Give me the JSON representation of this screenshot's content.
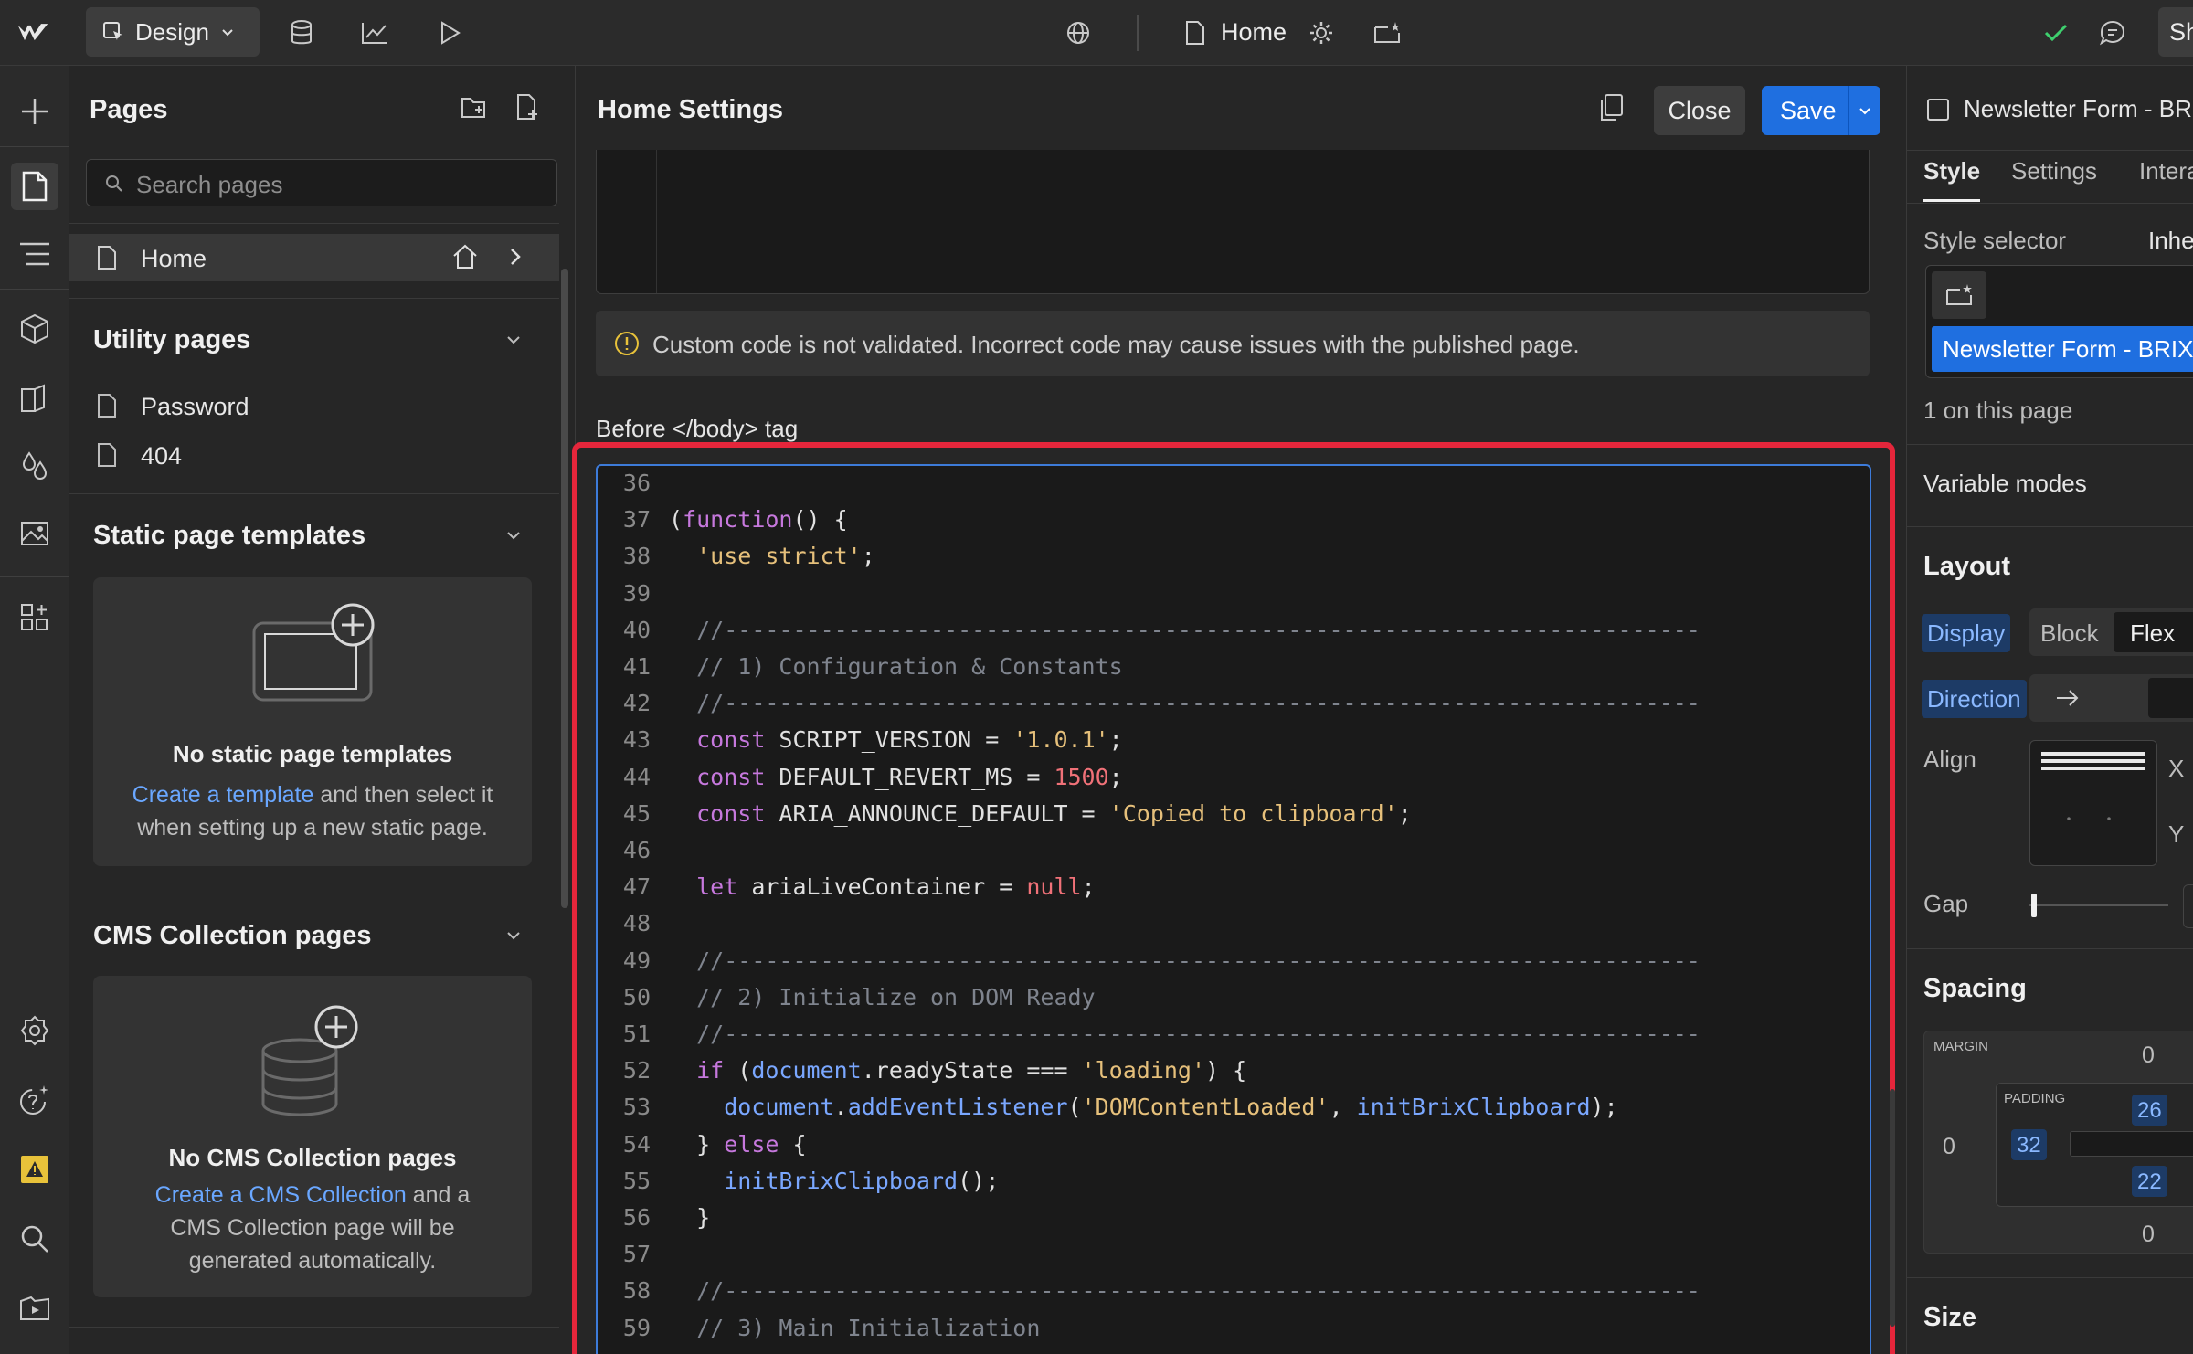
{
  "topbar": {
    "mode_label": "Design",
    "current_page": "Home",
    "share_label": "Sh"
  },
  "pages_panel": {
    "title": "Pages",
    "search_placeholder": "Search pages",
    "home_page": "Home",
    "utility": {
      "title": "Utility pages",
      "items": [
        "Password",
        "404"
      ]
    },
    "static_templates": {
      "title": "Static page templates",
      "empty_title": "No static page templates",
      "link": "Create a template",
      "desc_rest_1": " and then select it",
      "desc_rest_2": "when setting up a new static page."
    },
    "cms": {
      "title": "CMS Collection pages",
      "empty_title": "No CMS Collection pages",
      "link": "Create a CMS Collection",
      "desc_rest_1": " and a",
      "desc_rest_2": "CMS Collection page will be",
      "desc_rest_3": "generated automatically."
    }
  },
  "settings": {
    "title": "Home Settings",
    "close_label": "Close",
    "save_label": "Save",
    "warning": "Custom code is not validated. Incorrect code may cause issues with the published page.",
    "before_body_label": "Before </body> tag",
    "code_lines": [
      {
        "n": "36",
        "html": ""
      },
      {
        "n": "37",
        "html": "(<span class=\"k\">function</span>() {"
      },
      {
        "n": "38",
        "html": "  <span class=\"s\">'use strict'</span>;"
      },
      {
        "n": "39",
        "html": ""
      },
      {
        "n": "40",
        "html": "  <span class=\"c\">//-----------------------------------------------------------------------</span>"
      },
      {
        "n": "41",
        "html": "  <span class=\"c\">// 1) Configuration &amp; Constants</span>"
      },
      {
        "n": "42",
        "html": "  <span class=\"c\">//-----------------------------------------------------------------------</span>"
      },
      {
        "n": "43",
        "html": "  <span class=\"k\">const</span> SCRIPT_VERSION = <span class=\"s\">'1.0.1'</span>;"
      },
      {
        "n": "44",
        "html": "  <span class=\"k\">const</span> DEFAULT_REVERT_MS = <span class=\"n\">1500</span>;"
      },
      {
        "n": "45",
        "html": "  <span class=\"k\">const</span> ARIA_ANNOUNCE_DEFAULT = <span class=\"s\">'Copied to clipboard'</span>;"
      },
      {
        "n": "46",
        "html": ""
      },
      {
        "n": "47",
        "html": "  <span class=\"k\">let</span> ariaLiveContainer = <span class=\"n\">null</span>;"
      },
      {
        "n": "48",
        "html": ""
      },
      {
        "n": "49",
        "html": "  <span class=\"c\">//-----------------------------------------------------------------------</span>"
      },
      {
        "n": "50",
        "html": "  <span class=\"c\">// 2) Initialize on DOM Ready</span>"
      },
      {
        "n": "51",
        "html": "  <span class=\"c\">//-----------------------------------------------------------------------</span>"
      },
      {
        "n": "52",
        "html": "  <span class=\"k\">if</span> (<span class=\"f\">document</span>.readyState === <span class=\"s\">'loading'</span>) {"
      },
      {
        "n": "53",
        "html": "    <span class=\"f\">document</span>.<span class=\"f\">addEventListener</span>(<span class=\"s\">'DOMContentLoaded'</span>, <span class=\"f\">initBrixClipboard</span>);"
      },
      {
        "n": "54",
        "html": "  } <span class=\"k\">else</span> {"
      },
      {
        "n": "55",
        "html": "    <span class=\"f\">initBrixClipboard</span>();"
      },
      {
        "n": "56",
        "html": "  }"
      },
      {
        "n": "57",
        "html": ""
      },
      {
        "n": "58",
        "html": "  <span class=\"c\">//-----------------------------------------------------------------------</span>"
      },
      {
        "n": "59",
        "html": "  <span class=\"c\">// 3) Main Initialization</span>"
      }
    ]
  },
  "style_panel": {
    "element_name": "Newsletter Form - BR",
    "tabs": [
      "Style",
      "Settings",
      "Intera"
    ],
    "style_selector_label": "Style selector",
    "style_selector_value": "Inhe",
    "selector_chip": "Newsletter Form - BRIX",
    "on_page": "1 on this page",
    "variable_modes": "Variable modes",
    "layout": {
      "title": "Layout",
      "display_label": "Display",
      "display_options": [
        "Block",
        "Flex"
      ],
      "direction_label": "Direction",
      "align_label": "Align",
      "align_x": "X",
      "align_y": "Y",
      "gap_label": "Gap"
    },
    "spacing": {
      "title": "Spacing",
      "margin_label": "MARGIN",
      "padding_label": "PADDING",
      "margin_top": "0",
      "margin_left": "0",
      "margin_bottom": "0",
      "padding_top": "26",
      "padding_left": "32",
      "padding_bottom": "22"
    },
    "size_title": "Size"
  },
  "colors": {
    "accent": "#1f6fe0",
    "highlight": "#e5263b",
    "success": "#3ecf6e"
  }
}
